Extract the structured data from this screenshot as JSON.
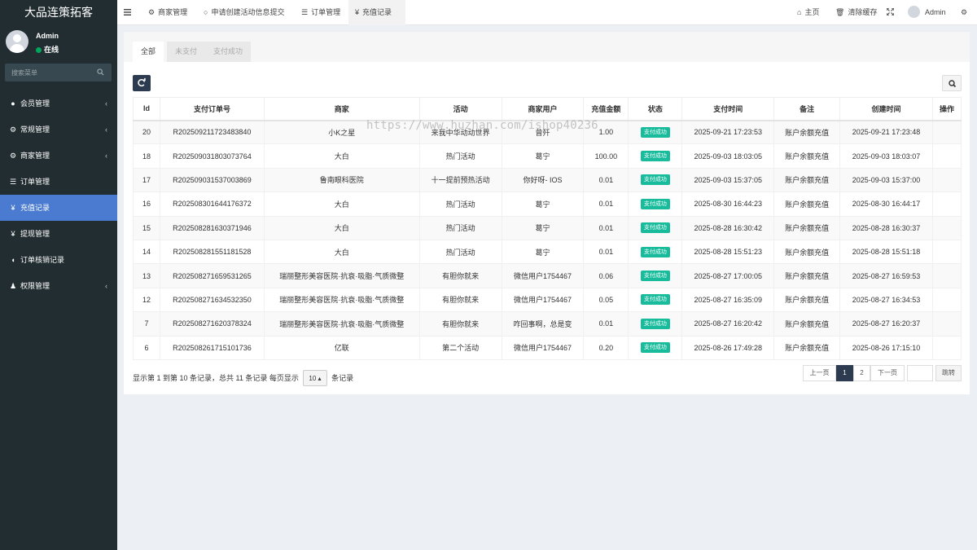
{
  "brand": "大品连策拓客",
  "user": {
    "name": "Admin",
    "status": "在线"
  },
  "side_search": {
    "placeholder": "搜索菜单"
  },
  "menu": [
    {
      "label": "会员管理",
      "icon": "user-circle-icon",
      "glyph": "●",
      "chevron": true
    },
    {
      "label": "常规管理",
      "icon": "cogs-icon",
      "glyph": "⚙",
      "chevron": true
    },
    {
      "label": "商家管理",
      "icon": "gear-icon",
      "glyph": "⚙",
      "chevron": true
    },
    {
      "label": "订单管理",
      "icon": "list-icon",
      "glyph": "☰",
      "chevron": false
    },
    {
      "label": "充值记录",
      "icon": "yen-icon",
      "glyph": "¥",
      "chevron": false,
      "active": true
    },
    {
      "label": "提现管理",
      "icon": "yen-icon",
      "glyph": "¥",
      "chevron": false
    },
    {
      "label": "订单核销记录",
      "icon": "shield-icon",
      "glyph": "◖",
      "chevron": false
    },
    {
      "label": "权限管理",
      "icon": "group-icon",
      "glyph": "♟",
      "chevron": true
    }
  ],
  "topbar": {
    "tabs": [
      {
        "label": "商家管理",
        "icon": "gear-icon",
        "glyph": "⚙"
      },
      {
        "label": "申请创建活动信息提交",
        "icon": "circle-icon",
        "glyph": "○"
      },
      {
        "label": "订单管理",
        "icon": "list-icon",
        "glyph": "☰"
      },
      {
        "label": "充值记录",
        "icon": "yen-icon",
        "glyph": "¥",
        "active": true
      }
    ],
    "home": "主页",
    "clear_cache": "清除缓存",
    "admin": "Admin"
  },
  "filter_tabs": [
    "全部",
    "未支付",
    "支付成功"
  ],
  "table": {
    "headers": [
      "Id",
      "支付订单号",
      "商家",
      "活动",
      "商家用户",
      "充值金额",
      "状态",
      "支付时间",
      "备注",
      "创建时间",
      "操作"
    ],
    "rows": [
      [
        "20",
        "R202509211723483840",
        "小K之星",
        "来我中华动动世界",
        "曾歼",
        "1.00",
        "支付成功",
        "2025-09-21 17:23:53",
        "账户余额充值",
        "2025-09-21 17:23:48",
        ""
      ],
      [
        "18",
        "R202509031803073764",
        "大白",
        "热门活动",
        "葛宁",
        "100.00",
        "支付成功",
        "2025-09-03 18:03:05",
        "账户余额充值",
        "2025-09-03 18:03:07",
        ""
      ],
      [
        "17",
        "R202509031537003869",
        "鲁南眼科医院",
        "十一提前预热活动",
        "你好呀- IOS",
        "0.01",
        "支付成功",
        "2025-09-03 15:37:05",
        "账户余额充值",
        "2025-09-03 15:37:00",
        ""
      ],
      [
        "16",
        "R202508301644176372",
        "大白",
        "热门活动",
        "葛宁",
        "0.01",
        "支付成功",
        "2025-08-30 16:44:23",
        "账户余额充值",
        "2025-08-30 16:44:17",
        ""
      ],
      [
        "15",
        "R202508281630371946",
        "大白",
        "热门活动",
        "葛宁",
        "0.01",
        "支付成功",
        "2025-08-28 16:30:42",
        "账户余额充值",
        "2025-08-28 16:30:37",
        ""
      ],
      [
        "14",
        "R202508281551181528",
        "大白",
        "热门活动",
        "葛宁",
        "0.01",
        "支付成功",
        "2025-08-28 15:51:23",
        "账户余额充值",
        "2025-08-28 15:51:18",
        ""
      ],
      [
        "13",
        "R202508271659531265",
        "瑞丽整形美容医院·抗衰·吸脂·气质微整",
        "有胆你就来",
        "微信用户1754467",
        "0.06",
        "支付成功",
        "2025-08-27 17:00:05",
        "账户余额充值",
        "2025-08-27 16:59:53",
        ""
      ],
      [
        "12",
        "R202508271634532350",
        "瑞丽整形美容医院·抗衰·吸脂·气质微整",
        "有胆你就来",
        "微信用户1754467",
        "0.05",
        "支付成功",
        "2025-08-27 16:35:09",
        "账户余额充值",
        "2025-08-27 16:34:53",
        ""
      ],
      [
        "7",
        "R202508271620378324",
        "瑞丽整形美容医院·抗衰·吸脂·气质微整",
        "有胆你就来",
        "咋回事啊，总是变",
        "0.01",
        "支付成功",
        "2025-08-27 16:20:42",
        "账户余额充值",
        "2025-08-27 16:20:37",
        ""
      ],
      [
        "6",
        "R202508261715101736",
        "亿联",
        "第二个活动",
        "微信用户1754467",
        "0.20",
        "支付成功",
        "2025-08-26 17:49:28",
        "账户余额充值",
        "2025-08-26 17:15:10",
        ""
      ]
    ]
  },
  "pagination": {
    "info_prefix": "显示第 1 到第 10 条记录，总共 11 条记录 每页显示",
    "page_size": "10",
    "info_suffix": "条记录",
    "prev": "上一页",
    "pages": [
      "1",
      "2"
    ],
    "next": "下一页",
    "jump": "跳转"
  },
  "watermark": "https://www.huzhan.com/ishop40236",
  "colors": {
    "sidebar": "#222d32",
    "active_menu": "#4a7bd0",
    "badge": "#18bc9c",
    "dark_button": "#2c3b4f"
  }
}
